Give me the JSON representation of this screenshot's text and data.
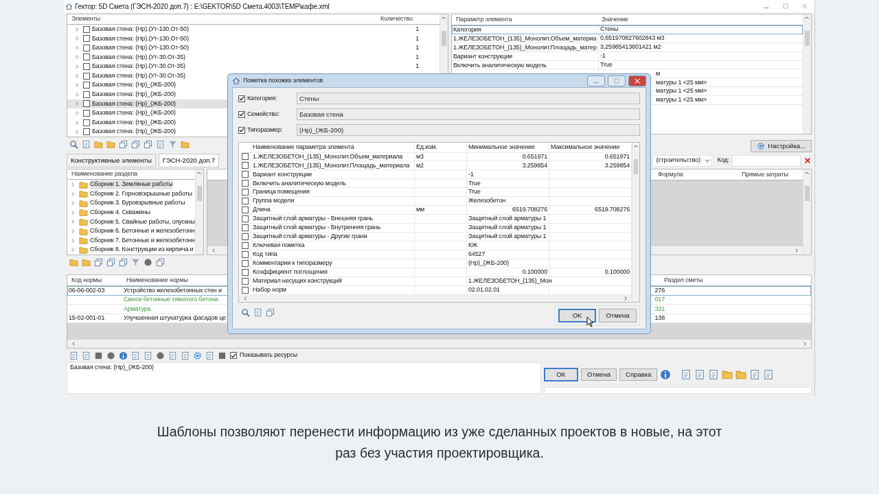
{
  "window": {
    "title": "Гектор: 5D Смета (ГЭСН-2020 доп.7) : E:\\GEKTOR\\5D Смета.4003\\TEMP\\кафе.xml"
  },
  "elements": {
    "columns": [
      "Элементы",
      "Количество"
    ],
    "rows": [
      {
        "label": "Базовая стена: (Нр).(Ут-130.От-50)",
        "count": "1",
        "checked": false,
        "selected": false
      },
      {
        "label": "Базовая стена: (Нр).(Ут-130.От-50)",
        "count": "1",
        "checked": false,
        "selected": false
      },
      {
        "label": "Базовая стена: (Нр).(Ут-130.От-50)",
        "count": "1",
        "checked": false,
        "selected": false
      },
      {
        "label": "Базовая стена: (Нр).(Ут-30.От-35)",
        "count": "1",
        "checked": false,
        "selected": false
      },
      {
        "label": "Базовая стена: (Нр).(Ут-30.От-35)",
        "count": "1",
        "checked": false,
        "selected": false
      },
      {
        "label": "Базовая стена: (Нр).(Ут-30.От-35)",
        "checked": false,
        "selected": false
      },
      {
        "label": "Базовая стена: (Нр)_(ЖБ-200)",
        "checked": false,
        "selected": false
      },
      {
        "label": "Базовая стена: (Нр)_(ЖБ-200)",
        "checked": false,
        "selected": false
      },
      {
        "label": "Базовая стена: (Нр)_(ЖБ-200)",
        "checked": false,
        "selected": true
      },
      {
        "label": "Базовая стена: (Нр)_(ЖБ-200)",
        "checked": false,
        "selected": false
      },
      {
        "label": "Базовая стена: (Нр)_(ЖБ-200)",
        "checked": false,
        "selected": false
      },
      {
        "label": "Базовая стена: (Нр)_(ЖБ-200)",
        "checked": false,
        "selected": false
      }
    ]
  },
  "parameters": {
    "columns": [
      "Параметр элемента",
      "Значение"
    ],
    "rows": [
      {
        "name": "Категория",
        "value": "Стены",
        "selected": true
      },
      {
        "name": "1.ЖЕЛЕЗОБЕТОН_(135)_Монолит.Объем_материа",
        "value": "0,651970827602843 м3",
        "selected": false
      },
      {
        "name": "1.ЖЕЛЕЗОБЕТОН_(135)_Монолит.Площадь_матер",
        "value": "3,25985413801421 м2",
        "selected": false
      },
      {
        "name": "Вариант конструкции",
        "value": "-1",
        "selected": false
      },
      {
        "name": "Включить аналитическую модель",
        "value": "True",
        "selected": false
      },
      {
        "kind": "clipped",
        "value": "м",
        "selected": false
      },
      {
        "kind": "clipped",
        "value": "матуры 1 <25 мм>",
        "selected": false
      },
      {
        "kind": "clipped",
        "value": "матуры 1 <25 мм>",
        "selected": false
      },
      {
        "kind": "clipped",
        "value": "матуры 1 <25 мм>",
        "selected": false
      }
    ]
  },
  "settings_button": "Настройка...",
  "catalog_tabs": [
    {
      "label": "Конструктивные элементы",
      "selected": false
    },
    {
      "label": "ГЭСН-2020 доп.7",
      "selected": true
    }
  ],
  "filter": {
    "combo_value": "(строительство)",
    "code_label": "Код:"
  },
  "sections": {
    "column": "Наименование раздела",
    "items": [
      {
        "label": "Сборник 1. Земляные работы",
        "selected": true
      },
      {
        "label": "Сборник 2. Горновскрышные работы",
        "selected": false
      },
      {
        "label": "Сборник 3. Буровзрывные работы",
        "selected": false
      },
      {
        "label": "Сборник 4. Скважины",
        "selected": false
      },
      {
        "label": "Сборник 5. Свайные работы, опускны",
        "selected": false
      },
      {
        "label": "Сборник 6. Бетонные и железобетонн",
        "selected": false
      },
      {
        "label": "Сборник 7. Бетонные и железобетонн",
        "selected": false
      },
      {
        "label": "Сборник 8. Конструкции из кирпича и",
        "selected": false
      }
    ]
  },
  "formula_grid": {
    "columns": [
      "Формула",
      "Прямые затраты"
    ]
  },
  "norms": {
    "columns": [
      "Код нормы",
      "Наименование нормы",
      "Раздел сметы"
    ],
    "rows": [
      {
        "kind": "norm",
        "code": "06-06-002-03",
        "name": "Устройство железобетонных стен и",
        "tail": "276",
        "selected": true
      },
      {
        "kind": "resource",
        "name": "Смеси бетонные тяжелого бетона",
        "tail": "017",
        "selected": false
      },
      {
        "kind": "resource",
        "name": "Арматура",
        "tail": "331",
        "selected": false
      },
      {
        "kind": "norm",
        "code": "15-02-001-01",
        "name": "Улучшенная штукатурка фасадов це",
        "tail": "138",
        "selected": false
      }
    ]
  },
  "show_resources": {
    "label": "Показывать ресурсы",
    "checked": true
  },
  "status_text": "Базовая стена: (Нр)_(ЖБ-200)",
  "buttons": [
    "OK",
    "Отмена",
    "Справка"
  ],
  "dialog": {
    "title": "Пометка похожих элементов",
    "filters": [
      {
        "label": "Категория:",
        "value": "Стены",
        "checked": true
      },
      {
        "label": "Семейство:",
        "value": "Базовая стена",
        "checked": true
      },
      {
        "label": "Типоразмер:",
        "value": "(Нр)_(ЖБ-200)",
        "checked": true
      }
    ],
    "columns": [
      "Наименование параметра элемента",
      "Ед.изм.",
      "Минимальное значение",
      "Максимальное значение"
    ],
    "rows": [
      {
        "kind": "number",
        "name": "1.ЖЕЛЕЗОБЕТОН_(135)_Монолит.Объем_материала",
        "unit": "м3",
        "min": "0.651971",
        "max": "0.651971",
        "checked": false
      },
      {
        "kind": "number",
        "name": "1.ЖЕЛЕЗОБЕТОН_(135)_Монолит.Площадь_материала",
        "unit": "м2",
        "min": "3.259854",
        "max": "3.259854",
        "checked": false
      },
      {
        "kind": "text",
        "name": "Вариант конструкции",
        "min": "-1",
        "checked": false
      },
      {
        "kind": "text",
        "name": "Включить аналитическую модель",
        "min": "True",
        "checked": false
      },
      {
        "kind": "text",
        "name": "Граница помещения",
        "min": "True",
        "checked": false
      },
      {
        "kind": "text",
        "name": "Группа модели",
        "min": "Железобетон",
        "checked": false
      },
      {
        "kind": "number",
        "name": "Длина",
        "unit": "мм",
        "min": "6519.708276",
        "max": "6519.708276",
        "checked": false
      },
      {
        "kind": "text",
        "name": "Защитный слой арматуры - Внешняя грань",
        "min": "Защитный слой арматуры 1",
        "checked": false
      },
      {
        "kind": "text",
        "name": "Защитный слой арматуры - Внутренняя грань",
        "min": "Защитный слой арматуры 1",
        "checked": false
      },
      {
        "kind": "text",
        "name": "Защитный слой арматуры - Другие грани",
        "min": "Защитный слой арматуры 1",
        "checked": false
      },
      {
        "kind": "text",
        "name": "Ключевая пометка",
        "min": "КЖ",
        "checked": false
      },
      {
        "kind": "text",
        "name": "Код типа",
        "min": "64527",
        "checked": false
      },
      {
        "kind": "text",
        "name": "Комментарии к типоразмеру",
        "min": "(Нр)_(ЖБ-200)",
        "checked": false
      },
      {
        "kind": "number",
        "name": "Коэффициент поглощения",
        "min": "0.100000",
        "max": "0.100000",
        "checked": false
      },
      {
        "kind": "text",
        "name": "Материал несущих конструкций",
        "min": "1.ЖЕЛЕЗОБЕТОН_(135)_Мон",
        "checked": false
      },
      {
        "kind": "text",
        "name": "Набор норм",
        "min": "02.01.02.01",
        "checked": false
      }
    ],
    "buttons": [
      "OK",
      "Отмена"
    ]
  },
  "caption": "Шаблоны позволяют перенести информацию из уже сделанных проектов в новые, на этот раз без участия проектировщика."
}
